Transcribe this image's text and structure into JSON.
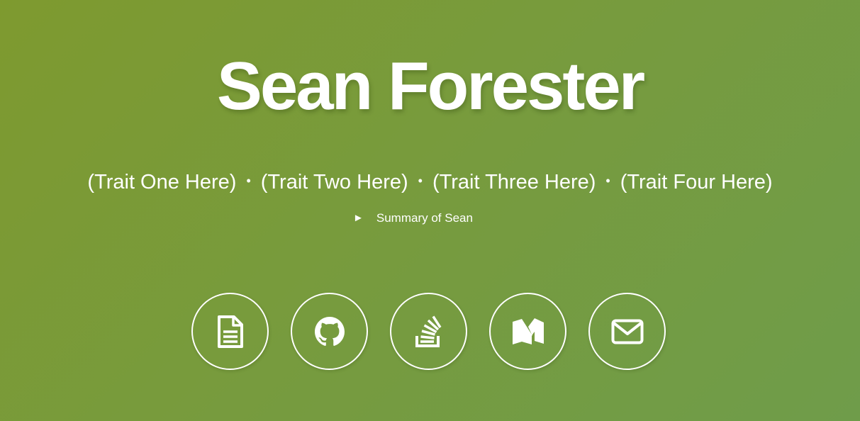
{
  "hero": {
    "name": "Sean Forester",
    "traits": [
      "(Trait One Here)",
      "(Trait Two Here)",
      "(Trait Three Here)",
      "(Trait Four Here)"
    ],
    "separator": "•",
    "summary_arrow": "►",
    "summary_label": "Summary of Sean"
  },
  "social_links": [
    {
      "icon": "document-icon"
    },
    {
      "icon": "github-icon"
    },
    {
      "icon": "stackoverflow-icon"
    },
    {
      "icon": "medium-icon"
    },
    {
      "icon": "email-icon"
    }
  ],
  "colors": {
    "background_start": "#7e9a2f",
    "background_end": "#6f9c4a",
    "foreground": "#ffffff"
  }
}
